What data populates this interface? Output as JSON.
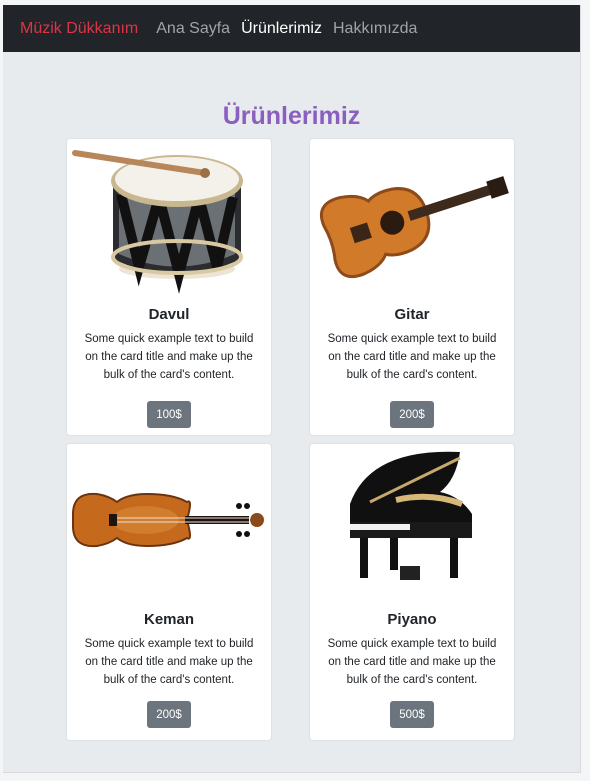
{
  "navbar": {
    "brand": "Müzik Dükkanım",
    "links": [
      {
        "label": "Ana Sayfa",
        "active": false
      },
      {
        "label": "Ürünlerimiz",
        "active": true
      },
      {
        "label": "Hakkımızda",
        "active": false
      }
    ]
  },
  "page": {
    "title": "Ürünlerimiz"
  },
  "products": [
    {
      "title": "Davul",
      "text": "Some quick example text to build on the card title and make up the bulk of the card's content.",
      "price": "100$",
      "image": "drum-image"
    },
    {
      "title": "Gitar",
      "text": "Some quick example text to build on the card title and make up the bulk of the card's content.",
      "price": "200$",
      "image": "guitar-image"
    },
    {
      "title": "Keman",
      "text": "Some quick example text to build on the card title and make up the bulk of the card's content.",
      "price": "200$",
      "image": "violin-image"
    },
    {
      "title": "Piyano",
      "text": "Some quick example text to build on the card title and make up the bulk of the card's content.",
      "price": "500$",
      "image": "piano-image"
    }
  ],
  "colors": {
    "navbar_bg": "#212529",
    "brand": "#dc3545",
    "title": "#8a5fbf",
    "button": "#6c757d"
  }
}
